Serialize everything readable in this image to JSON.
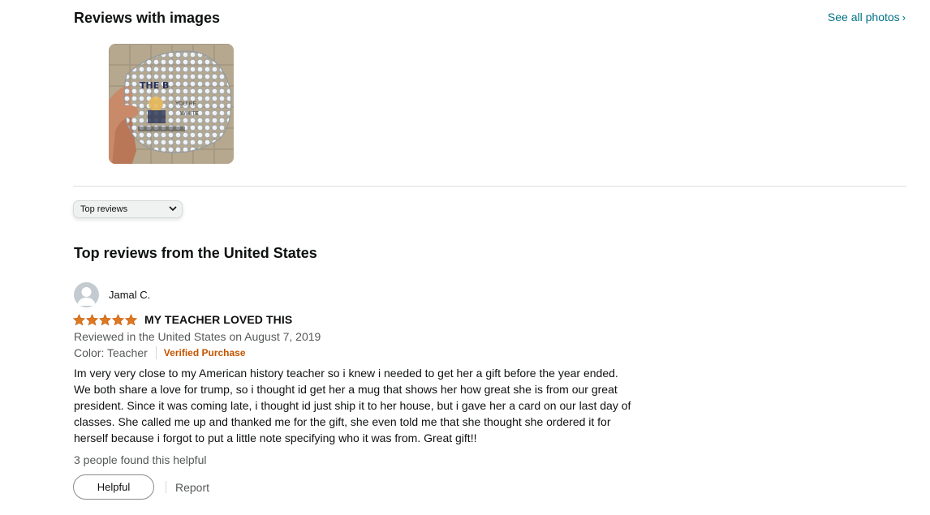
{
  "images_section": {
    "title": "Reviews with images",
    "see_all_label": "See all photos",
    "see_all_chevron": "›"
  },
  "sort": {
    "selected": "Top reviews"
  },
  "reviews_section": {
    "title": "Top reviews from the United States"
  },
  "review": {
    "author": "Jamal C.",
    "rating": 5,
    "rating_max": 5,
    "title": "MY TEACHER LOVED THIS",
    "date_line": "Reviewed in the United States on August 7, 2019",
    "variant": "Color: Teacher",
    "verified_label": "Verified Purchase",
    "body": "Im very very close to my American history teacher so i knew i needed to get her a gift before the year ended. We both share a love for trump, so i thought id get her a mug that shows her how great she is from our great president. Since it was coming late, i thought id just ship it to her house, but i gave her a card on our last day of classes. She called me up and thanked me for the gift, she even told me that she thought she ordered it for herself because i forgot to put a little note specifying who it was from. Great gift!!",
    "helpful_count_text": "3 people found this helpful",
    "helpful_button": "Helpful",
    "report_label": "Report"
  },
  "colors": {
    "link": "#007185",
    "star": "#de7921",
    "verified": "#c45500",
    "muted": "#565959"
  }
}
